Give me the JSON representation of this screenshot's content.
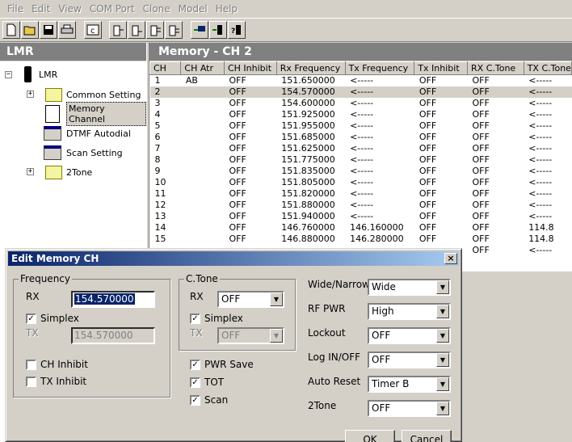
{
  "menu": [
    "File",
    "Edit",
    "View",
    "COM Port",
    "Clone",
    "Model",
    "Help"
  ],
  "toolbar": [
    "new-icon",
    "open-icon",
    "save-icon",
    "print-icon",
    "c-icon",
    "read-radio-icon",
    "write-radio-icon",
    "read-all-icon",
    "write-all-icon",
    "pc-to-radio-icon",
    "radio-to-pc-icon",
    "radio-info-icon"
  ],
  "left_panel": {
    "title": "LMR"
  },
  "tree": {
    "root": "LMR",
    "items": [
      "Common Setting",
      "Memory Channel",
      "DTMF Autodial",
      "Scan Setting",
      "2Tone"
    ]
  },
  "right_panel": {
    "title": "Memory - CH 2"
  },
  "grid": {
    "columns": [
      "CH",
      "CH Atr",
      "CH Inhibit",
      "Rx Frequency",
      "Tx Frequency",
      "Tx Inhibit",
      "RX C.Tone",
      "TX C.Tone"
    ],
    "rows": [
      [
        "1",
        "AB",
        "OFF",
        "151.650000",
        "<-----",
        "OFF",
        "OFF",
        "<-----"
      ],
      [
        "2",
        "",
        "OFF",
        "154.570000",
        "<-----",
        "OFF",
        "OFF",
        "<-----"
      ],
      [
        "3",
        "",
        "OFF",
        "154.600000",
        "<-----",
        "OFF",
        "OFF",
        "<-----"
      ],
      [
        "4",
        "",
        "OFF",
        "151.925000",
        "<-----",
        "OFF",
        "OFF",
        "<-----"
      ],
      [
        "5",
        "",
        "OFF",
        "151.955000",
        "<-----",
        "OFF",
        "OFF",
        "<-----"
      ],
      [
        "6",
        "",
        "OFF",
        "151.685000",
        "<-----",
        "OFF",
        "OFF",
        "<-----"
      ],
      [
        "7",
        "",
        "OFF",
        "151.625000",
        "<-----",
        "OFF",
        "OFF",
        "<-----"
      ],
      [
        "8",
        "",
        "OFF",
        "151.775000",
        "<-----",
        "OFF",
        "OFF",
        "<-----"
      ],
      [
        "9",
        "",
        "OFF",
        "151.835000",
        "<-----",
        "OFF",
        "OFF",
        "<-----"
      ],
      [
        "10",
        "",
        "OFF",
        "151.805000",
        "<-----",
        "OFF",
        "OFF",
        "<-----"
      ],
      [
        "11",
        "",
        "OFF",
        "151.820000",
        "<-----",
        "OFF",
        "OFF",
        "<-----"
      ],
      [
        "12",
        "",
        "OFF",
        "151.880000",
        "<-----",
        "OFF",
        "OFF",
        "<-----"
      ],
      [
        "13",
        "",
        "OFF",
        "151.940000",
        "<-----",
        "OFF",
        "OFF",
        "<-----"
      ],
      [
        "14",
        "",
        "OFF",
        "146.760000",
        "146.160000",
        "OFF",
        "OFF",
        "114.8"
      ],
      [
        "15",
        "",
        "OFF",
        "146.880000",
        "146.280000",
        "OFF",
        "OFF",
        "114.8"
      ],
      [
        "",
        "",
        "",
        "",
        "",
        "",
        "OFF",
        "<-----"
      ]
    ]
  },
  "dialog": {
    "title": "Edit Memory CH",
    "close": "×",
    "frequency": {
      "label": "Frequency",
      "rx_label": "RX",
      "rx_value": "154.570000",
      "simplex_label": "Simplex",
      "tx_label": "TX",
      "tx_value": "154.570000",
      "ch_inhibit_label": "CH Inhibit",
      "tx_inhibit_label": "TX Inhibit"
    },
    "ctone": {
      "label": "C.Tone",
      "rx_label": "RX",
      "rx_value": "OFF",
      "simplex_label": "Simplex",
      "tx_label": "TX",
      "tx_value": "OFF"
    },
    "pwr_save_label": "PWR Save",
    "tot_label": "TOT",
    "scan_label": "Scan",
    "wide_narrow": {
      "label": "Wide/Narrow",
      "value": "Wide"
    },
    "rf_pwr": {
      "label": "RF PWR",
      "value": "High"
    },
    "lockout": {
      "label": "Lockout",
      "value": "OFF"
    },
    "log_in_off": {
      "label": "Log IN/OFF",
      "value": "OFF"
    },
    "auto_reset": {
      "label": "Auto Reset",
      "value": "Timer B"
    },
    "two_tone": {
      "label": "2Tone",
      "value": "OFF"
    },
    "ok_label": "OK",
    "cancel_label": "Cancel"
  },
  "colors": {
    "title_bar_start": "#0a246a",
    "title_bar_end": "#a6caf0",
    "panel_header": "#808080",
    "face": "#d4d0c8"
  }
}
